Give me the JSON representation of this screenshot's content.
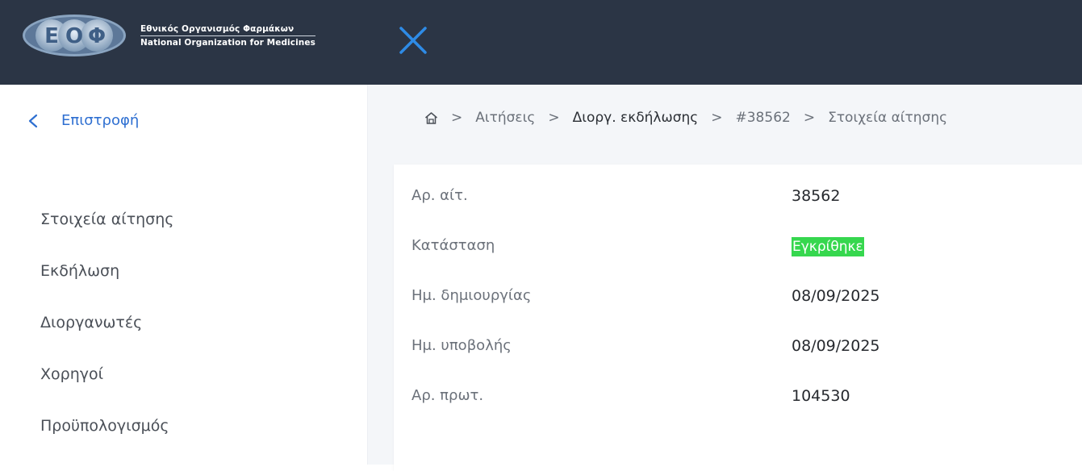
{
  "header": {
    "logo_line1": "Εθνικός Οργανισμός Φαρμάκων",
    "logo_line2": "National Organization for Medicines",
    "close_icon": "close-x-icon",
    "bg_color": "#2b3545",
    "accent_color": "#2e8be6"
  },
  "sidebar": {
    "back_label": "Επιστροφή",
    "items": [
      {
        "label": "Στοιχεία αίτησης"
      },
      {
        "label": "Εκδήλωση"
      },
      {
        "label": "Διοργανωτές"
      },
      {
        "label": "Χορηγοί"
      },
      {
        "label": "Προϋπολογισμός"
      }
    ]
  },
  "breadcrumb": {
    "items": [
      "Αιτήσεις",
      "Διοργ. εκδήλωσης",
      "#38562",
      "Στοιχεία αίτησης"
    ]
  },
  "details": {
    "fields": [
      {
        "label": "Αρ. αίτ.",
        "value": "38562"
      },
      {
        "label": "Κατάσταση",
        "value": "Εγκρίθηκε"
      },
      {
        "label": "Ημ. δημιουργίας",
        "value": "08/09/2025"
      },
      {
        "label": "Ημ. υποβολής",
        "value": "08/09/2025"
      },
      {
        "label": "Αρ. πρωτ.",
        "value": "104530"
      }
    ],
    "status_color": "#36d74e"
  }
}
